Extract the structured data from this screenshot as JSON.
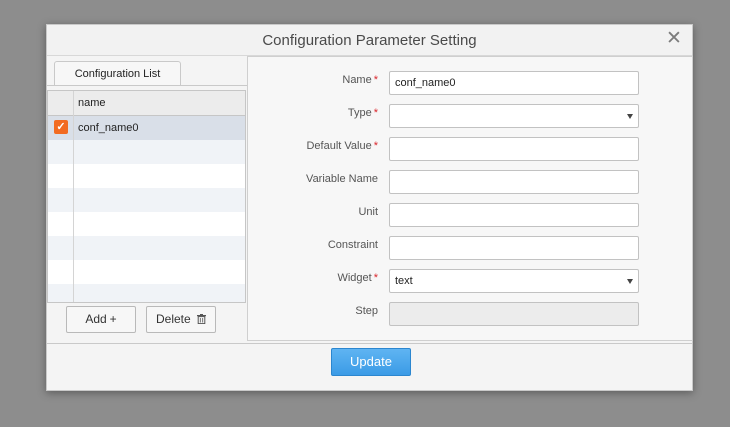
{
  "dialog": {
    "title": "Configuration Parameter Setting",
    "close_icon": "close-icon"
  },
  "left_panel": {
    "tab_label": "Configuration List",
    "grid": {
      "column_header": "name",
      "rows": [
        {
          "checked": true,
          "name": "conf_name0"
        }
      ]
    },
    "add_label": "Add",
    "add_icon": "plus-icon",
    "delete_label": "Delete",
    "delete_icon": "trash-icon"
  },
  "form": {
    "name": {
      "label": "Name",
      "required": "*",
      "value": "conf_name0"
    },
    "type": {
      "label": "Type",
      "required": "*",
      "value": ""
    },
    "default_value": {
      "label": "Default Value",
      "required": "*",
      "value": ""
    },
    "variable_name": {
      "label": "Variable Name",
      "value": ""
    },
    "unit": {
      "label": "Unit",
      "value": ""
    },
    "constraint": {
      "label": "Constraint",
      "value": ""
    },
    "widget": {
      "label": "Widget",
      "required": "*",
      "value": "text"
    },
    "step": {
      "label": "Step",
      "value": ""
    }
  },
  "footer": {
    "update_label": "Update"
  },
  "colors": {
    "accent": "#3b9be6",
    "required": "#d9262c",
    "checkbox": "#f26b21",
    "selected_row": "#d9dfe8"
  }
}
